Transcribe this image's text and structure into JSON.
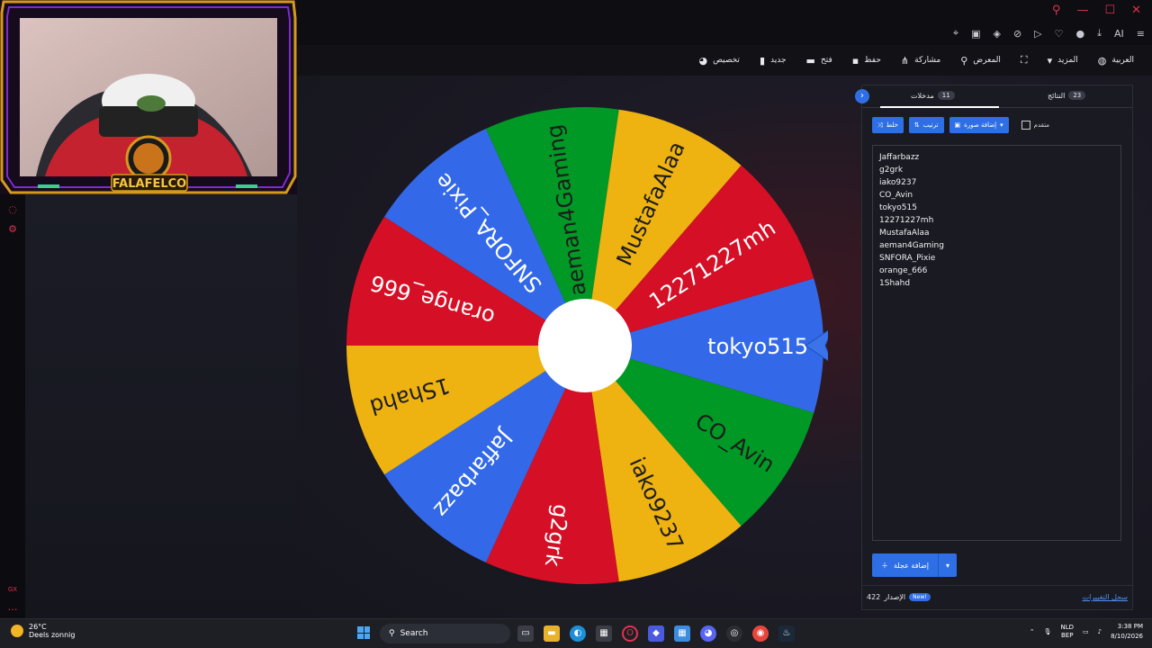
{
  "toolbar": {
    "items": [
      {
        "label": "العربية",
        "icon": "globe-icon"
      },
      {
        "label": "المزيد",
        "icon": "caret-down-icon"
      },
      {
        "label": "",
        "icon": "fullscreen-icon"
      },
      {
        "label": "المعرض",
        "icon": "search-icon"
      },
      {
        "label": "مشاركة",
        "icon": "share-icon"
      },
      {
        "label": "حفظ",
        "icon": "save-icon"
      },
      {
        "label": "فتح",
        "icon": "folder-icon"
      },
      {
        "label": "جديد",
        "icon": "file-icon"
      },
      {
        "label": "تخصيص",
        "icon": "palette-icon"
      }
    ]
  },
  "browser": {
    "ai_label": "AI"
  },
  "webcam": {
    "brand": "FALAFELCO"
  },
  "wheel": {
    "selected": "tokyo515",
    "colors": [
      "#3369e8",
      "#009925",
      "#eeb211",
      "#d50f25"
    ],
    "segments": [
      {
        "name": "tokyo515",
        "color": "#3369e8"
      },
      {
        "name": "CO_Avin",
        "color": "#009925"
      },
      {
        "name": "iako9237",
        "color": "#eeb211"
      },
      {
        "name": "g2grk",
        "color": "#d50f25"
      },
      {
        "name": "Jaffarbazz",
        "color": "#3369e8"
      },
      {
        "name": "1Shahd",
        "color": "#eeb211"
      },
      {
        "name": "orange_666",
        "color": "#d50f25"
      },
      {
        "name": "SNFORA_Pixie",
        "color": "#3369e8"
      },
      {
        "name": "aeman4Gaming",
        "color": "#009925"
      },
      {
        "name": "MustafaAlaa",
        "color": "#eeb211"
      },
      {
        "name": "12271227mh",
        "color": "#d50f25"
      }
    ]
  },
  "panel": {
    "tabs": [
      {
        "label": "مدخلات",
        "count": "11"
      },
      {
        "label": "النتائج",
        "count": "23"
      }
    ],
    "buttons": {
      "shuffle": "خلط",
      "sort": "ترتيب",
      "add_image": "إضافة صورة",
      "advanced": "متقدم"
    },
    "entries": [
      "Jaffarbazz",
      "g2grk",
      "iako9237",
      "CO_Avin",
      "tokyo515",
      "12271227mh",
      "MustafaAlaa",
      "aeman4Gaming",
      "SNFORA_Pixie",
      "orange_666",
      "1Shahd"
    ],
    "add_wheel": "إضافة عجلة",
    "version_label": "الإصدار",
    "version_number": "422",
    "new_badge": "New!",
    "changelog": "سجل التغييرات"
  },
  "taskbar": {
    "temperature": "26°C",
    "weather": "Deels zonnig",
    "search": "Search",
    "lang_top": "NLD",
    "lang_bottom": "BEP",
    "time": "3:38 PM",
    "date": "8/10/2026"
  }
}
